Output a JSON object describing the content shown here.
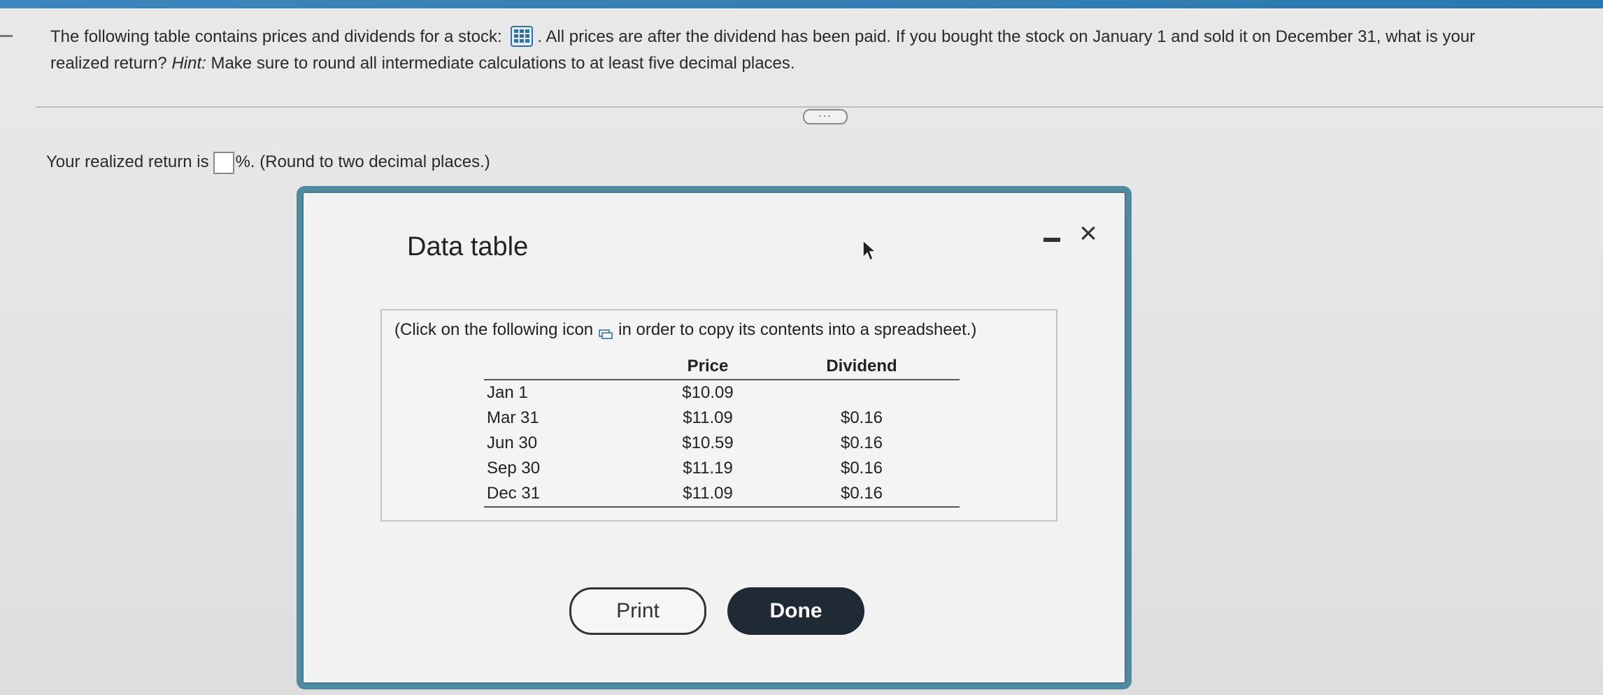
{
  "question": {
    "line1_part1": "The following table contains prices and dividends for a stock:",
    "line1_part2": ". All prices are after the dividend has been paid. If you bought the stock on January 1 and sold it on December 31, what is your",
    "line2_part1": "realized return?",
    "hint_label": "Hint:",
    "line2_part2": "Make sure to round all intermediate calculations to at least five decimal places."
  },
  "more_button": "...",
  "answer": {
    "prefix": "Your realized return is",
    "suffix": "%. (Round to two decimal places.)"
  },
  "dialog": {
    "title": "Data table",
    "close_glyph": "×",
    "note_part1": "(Click on the following icon",
    "note_part2": "in order to copy its contents into a spreadsheet.)",
    "table": {
      "headers": [
        "",
        "Price",
        "Dividend"
      ],
      "rows": [
        {
          "date": "Jan 1",
          "price": "$10.09",
          "dividend": ""
        },
        {
          "date": "Mar 31",
          "price": "$11.09",
          "dividend": "$0.16"
        },
        {
          "date": "Jun 30",
          "price": "$10.59",
          "dividend": "$0.16"
        },
        {
          "date": "Sep 30",
          "price": "$11.19",
          "dividend": "$0.16"
        },
        {
          "date": "Dec 31",
          "price": "$11.09",
          "dividend": "$0.16"
        }
      ]
    },
    "print_label": "Print",
    "done_label": "Done"
  },
  "colors": {
    "topbar": "#3c86bc",
    "dialog_border": "#4f8a9e",
    "done_bg": "#1f2a35"
  }
}
